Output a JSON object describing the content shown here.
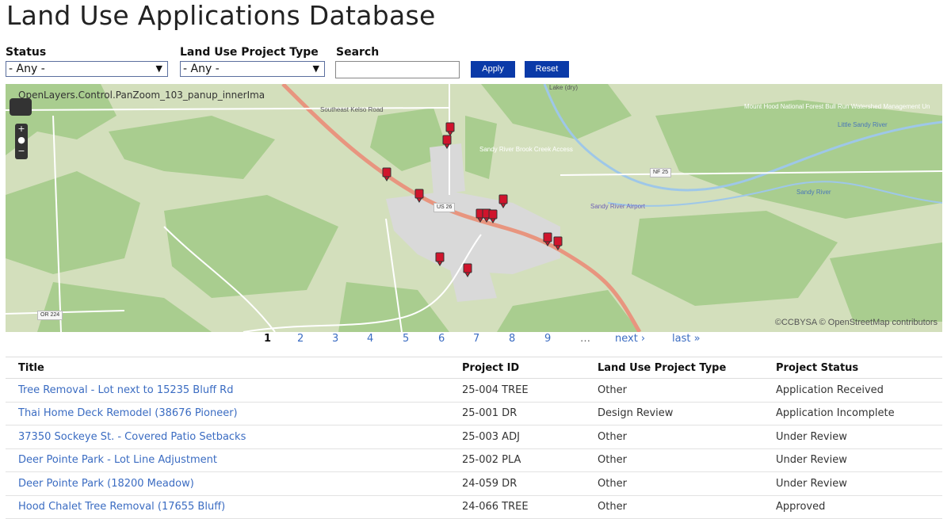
{
  "page": {
    "title": "Land Use Applications Database"
  },
  "filters": {
    "status": {
      "label": "Status",
      "value": "- Any -"
    },
    "project_type": {
      "label": "Land Use Project Type",
      "value": "- Any -"
    },
    "search": {
      "label": "Search",
      "value": ""
    },
    "apply_label": "Apply",
    "reset_label": "Reset"
  },
  "map": {
    "broken_image_alt": "OpenLayers.Control.PanZoom_103_panup_innerIma",
    "attribution": "©CCBYSA © OpenStreetMap contributors",
    "labels": {
      "road_north": "Southeast Kelso Road",
      "forest": "Mount Hood National Forest  Bull Run Watershed Management Un",
      "river_north": "Little Sandy River",
      "sandy_river": "Sandy River",
      "airport": "Sandy River Airport",
      "creek": "Sandy River Brook Creek Access",
      "lake": "Lake (dry)"
    },
    "road_badges": {
      "us26": "US 26",
      "nf25": "NF 25",
      "or224": "OR 224"
    },
    "marker_count": 14,
    "colors": {
      "marker": "#d0142c",
      "land": "#d3dfbc",
      "forest": "#a9cd8f",
      "urban": "#d9d9d9",
      "highway": "#e8957f"
    }
  },
  "pager": {
    "current": "1",
    "pages": [
      "2",
      "3",
      "4",
      "5",
      "6",
      "7",
      "8",
      "9"
    ],
    "ellipsis": "…",
    "next": "next ›",
    "last": "last »"
  },
  "table": {
    "headers": [
      "Title",
      "Project ID",
      "Land Use Project Type",
      "Project Status"
    ],
    "rows": [
      [
        "Tree Removal - Lot next to 15235 Bluff Rd",
        "25-004 TREE",
        "Other",
        "Application Received"
      ],
      [
        "Thai Home Deck Remodel (38676 Pioneer)",
        "25-001 DR",
        "Design Review",
        "Application Incomplete"
      ],
      [
        "37350 Sockeye St. - Covered Patio Setbacks",
        "25-003 ADJ",
        "Other",
        "Under Review"
      ],
      [
        "Deer Pointe Park - Lot Line Adjustment",
        "25-002 PLA",
        "Other",
        "Under Review"
      ],
      [
        "Deer Pointe Park (18200 Meadow)",
        "24-059 DR",
        "Other",
        "Under Review"
      ],
      [
        "Hood Chalet Tree Removal (17655 Bluff)",
        "24-066 TREE",
        "Other",
        "Approved"
      ]
    ]
  }
}
